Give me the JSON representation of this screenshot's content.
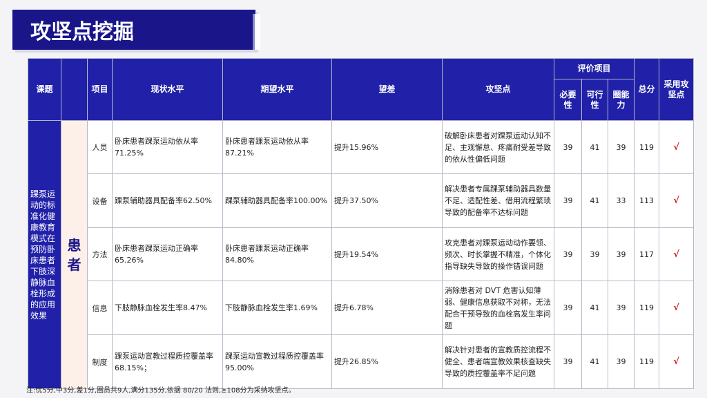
{
  "title": "攻坚点挖掘",
  "headers": {
    "topic": "课题",
    "item": "项目",
    "current": "现状水平",
    "expected": "期望水平",
    "gap": "望差",
    "key_point": "攻坚点",
    "eval": "评价项目",
    "necessity": "必要性",
    "feasibility": "可行性",
    "ability": "圈能力",
    "total": "总分",
    "adopt": "采用攻坚点"
  },
  "topic_text": "踝泵运动的标准化健康教育模式在预防卧床患者下肢深静脉血栓形成的应用效果",
  "group_label": "患者",
  "rows": [
    {
      "item": "人员",
      "current": "卧床患者踝泵运动依从率71.25%",
      "expected": "卧床患者踝泵运动依从率87.21%",
      "gap": "提升15.96%",
      "key_point": "破解卧床患者对踝泵运动认知不足、主观懈怠、疼痛耐受差导致的依从性偏低问题",
      "necessity": "39",
      "feasibility": "41",
      "ability": "39",
      "total": "119",
      "adopt": "√"
    },
    {
      "item": "设备",
      "current": "踝泵辅助器具配备率62.50%",
      "expected": "踝泵辅助器具配备率100.00%",
      "gap": "提升37.50%",
      "key_point": "解决患者专属踝泵辅助器具数量不足、适配性差、借用流程繁琐导致的配备率不达标问题",
      "necessity": "39",
      "feasibility": "41",
      "ability": "33",
      "total": "113",
      "adopt": "√"
    },
    {
      "item": "方法",
      "current": "卧床患者踝泵运动正确率65.26%",
      "expected": "卧床患者踝泵运动正确率84.80%",
      "gap": "提升19.54%",
      "key_point": "攻克患者对踝泵运动动作要领、频次、时长掌握不精准，个体化指导缺失导致的操作错误问题",
      "necessity": "39",
      "feasibility": "39",
      "ability": "39",
      "total": "117",
      "adopt": "√"
    },
    {
      "item": "信息",
      "current": "下肢静脉血栓发生率8.47%",
      "expected": "下肢静脉血栓发生率1.69%",
      "gap": "提升6.78%",
      "key_point": "消除患者对 DVT 危害认知薄弱、健康信息获取不对称，无法配合干预导致的血栓高发生率问题",
      "necessity": "39",
      "feasibility": "41",
      "ability": "39",
      "total": "119",
      "adopt": "√"
    },
    {
      "item": "制度",
      "current": "踝泵运动宣教过程质控覆盖率 68.15%；",
      "expected": "踝泵运动宣教过程质控覆盖率95.00%",
      "gap": "提升26.85%",
      "key_point": "解决针对患者的宣教质控流程不健全、患者端宣教效果核查缺失导致的质控覆盖率不足问题",
      "necessity": "39",
      "feasibility": "41",
      "ability": "39",
      "total": "119",
      "adopt": "√"
    }
  ],
  "note": "注:优5分,中3分,差1分,圈员共9人,满分135分,依据 80/20 法则,≥108分为采纳攻坚点。"
}
